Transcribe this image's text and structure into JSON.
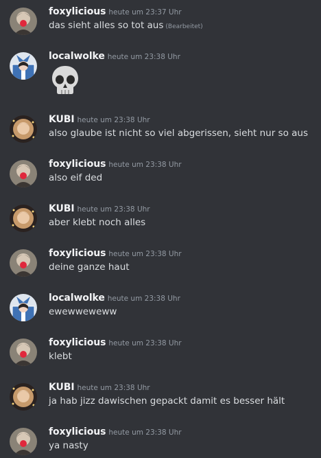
{
  "messages": [
    {
      "avatar": "foxy-avatar-icon",
      "username": "foxylicious",
      "timestamp": "heute um 23:37 Uhr",
      "text": "das sieht alles so tot aus",
      "edited": "(Bearbeitet)"
    },
    {
      "avatar": "localwolke-avatar-icon",
      "username": "localwolke",
      "timestamp": "heute um 23:38 Uhr",
      "emoji": "skull-emoji-icon"
    },
    {
      "avatar": "kubi-avatar-icon",
      "username": "KUBI",
      "timestamp": "heute um 23:38 Uhr",
      "text": "also glaube ist nicht so viel abgerissen, sieht nur so aus"
    },
    {
      "avatar": "foxy-avatar-icon",
      "username": "foxylicious",
      "timestamp": "heute um 23:38 Uhr",
      "text": "also eif ded"
    },
    {
      "avatar": "kubi-avatar-icon",
      "username": "KUBI",
      "timestamp": "heute um 23:38 Uhr",
      "text": "aber klebt noch alles"
    },
    {
      "avatar": "foxy-avatar-icon",
      "username": "foxylicious",
      "timestamp": "heute um 23:38 Uhr",
      "text": "deine ganze haut"
    },
    {
      "avatar": "localwolke-avatar-icon",
      "username": "localwolke",
      "timestamp": "heute um 23:38 Uhr",
      "text": "ewewweweww"
    },
    {
      "avatar": "foxy-avatar-icon",
      "username": "foxylicious",
      "timestamp": "heute um 23:38 Uhr",
      "text": "klebt"
    },
    {
      "avatar": "kubi-avatar-icon",
      "username": "KUBI",
      "timestamp": "heute um 23:38 Uhr",
      "text": "ja hab jizz dawischen gepackt damit es besser hält"
    },
    {
      "avatar": "foxy-avatar-icon",
      "username": "foxylicious",
      "timestamp": "heute um 23:38 Uhr",
      "text": "ya nasty"
    }
  ],
  "colors": {
    "background": "#313338",
    "username": "#f2f3f5",
    "timestamp": "#949ba4",
    "text": "#dbdee1"
  }
}
